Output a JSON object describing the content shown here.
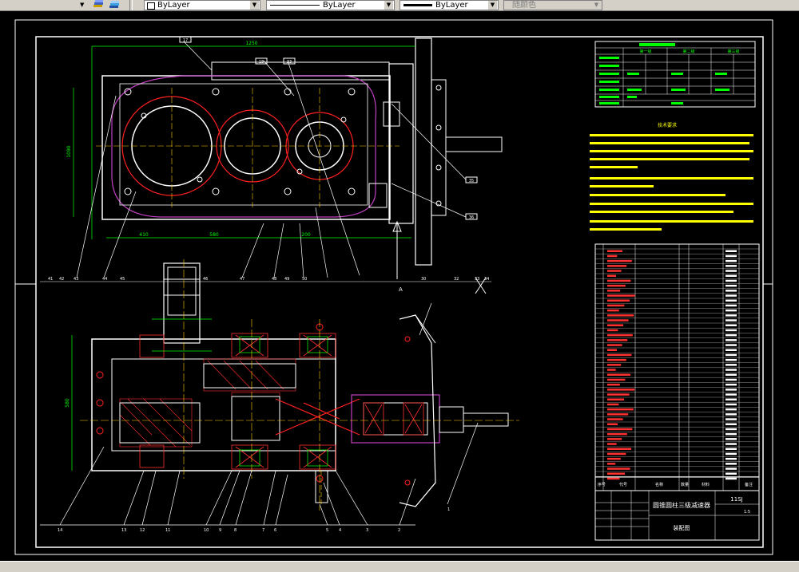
{
  "toolbar": {
    "layer_icons": [
      "layer-manager-icon",
      "layer-state-icon"
    ],
    "color_control": "ByLayer",
    "linetype_control": "ByLayer",
    "lineweight_control": "ByLayer",
    "plotstyle_control": "随颜色"
  },
  "drawing": {
    "title": "圆锥圆柱三级减速器",
    "subtitle": "装配图",
    "drawing_number": "11SJ",
    "notes_heading": "技术要求",
    "scale_label": "1:5",
    "dim_top": "1250",
    "dim_left": "1090",
    "dim_left_lower": "580",
    "dim_bottom_a": "410",
    "dim_bottom_b": "580",
    "dim_bottom_c": "200",
    "title_block_labels": [
      "序号",
      "代号",
      "名称",
      "数量",
      "材料",
      "备注"
    ],
    "gear_table_headers": [
      "第一级",
      "第二级",
      "第三级"
    ],
    "top_callouts": [
      "17",
      "18",
      "23",
      "21",
      "35",
      "36"
    ],
    "mid_callouts": [
      "41",
      "42",
      "43",
      "44",
      "45",
      "46",
      "47",
      "48",
      "49",
      "50",
      "30",
      "32",
      "33",
      "34"
    ],
    "bottom_callouts": [
      "14",
      "13",
      "12",
      "11",
      "10",
      "9",
      "8",
      "7",
      "6",
      "5",
      "4",
      "3",
      "2",
      "1"
    ]
  }
}
